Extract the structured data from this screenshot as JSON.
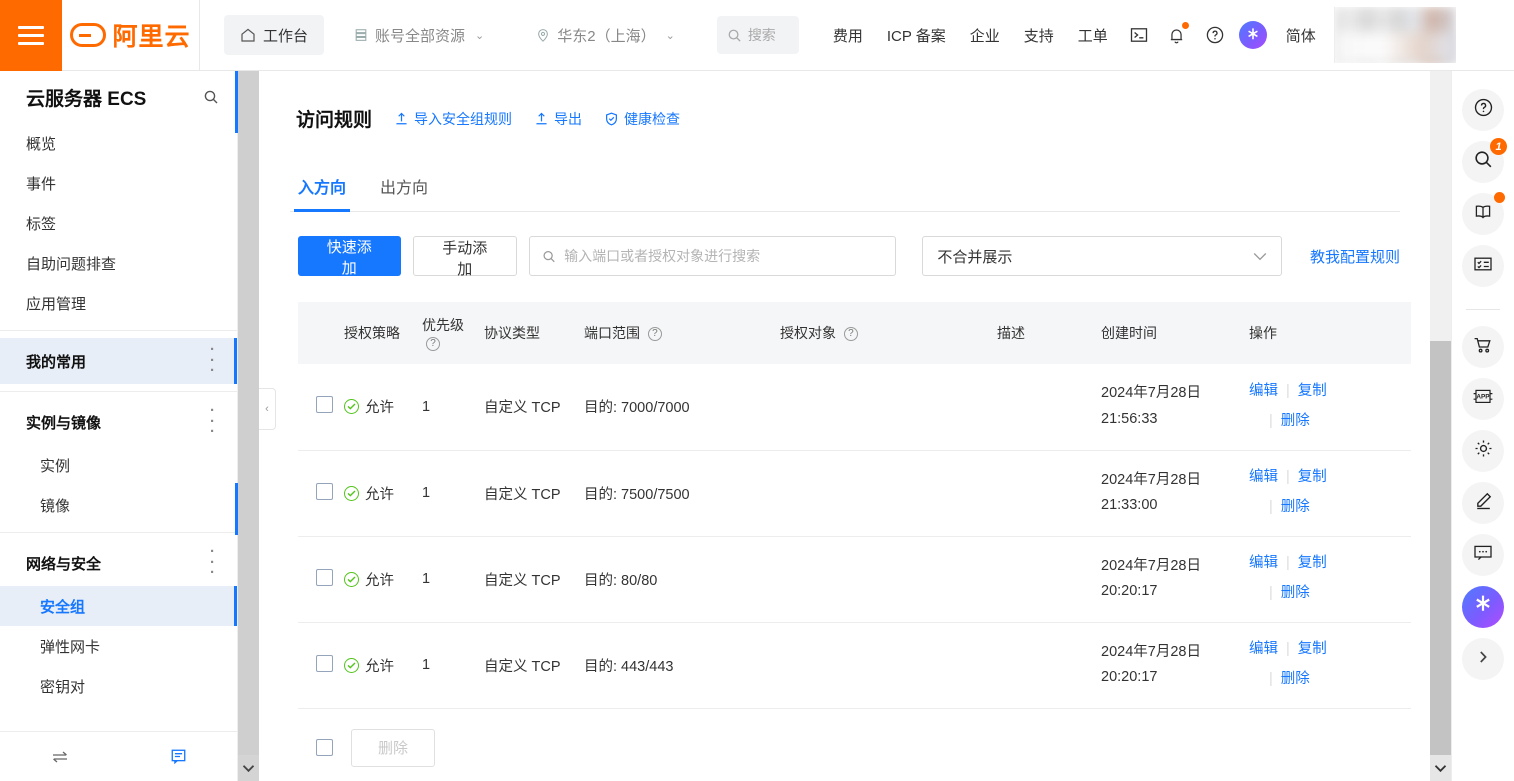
{
  "header": {
    "menu_icon": "hamburger-icon",
    "logo_text": "阿里云",
    "workbench": "工作台",
    "home_icon": "home-icon",
    "resources": "账号全部资源",
    "resources_icon": "server-icon",
    "region": "华东2（上海）",
    "region_icon": "location-pin-icon",
    "search_placeholder": "搜索",
    "search_icon": "search-icon",
    "links": [
      "费用",
      "ICP 备案",
      "企业",
      "支持",
      "工单"
    ],
    "icons": [
      "terminal-icon",
      "bell-icon",
      "question-circle-icon"
    ],
    "ai_icon": "ai-assistant-icon",
    "language": "简体"
  },
  "sidebar": {
    "title": "云服务器 ECS",
    "search_icon": "search-icon",
    "items": [
      {
        "label": "概览",
        "type": "item"
      },
      {
        "label": "事件",
        "type": "item"
      },
      {
        "label": "标签",
        "type": "item"
      },
      {
        "label": "自助问题排查",
        "type": "item"
      },
      {
        "label": "应用管理",
        "type": "item"
      }
    ],
    "groups": [
      {
        "label": "我的常用",
        "selected": true,
        "children": []
      },
      {
        "label": "实例与镜像",
        "selected": false,
        "children": [
          {
            "label": "实例",
            "active": false
          },
          {
            "label": "镜像",
            "active": false
          }
        ]
      },
      {
        "label": "网络与安全",
        "selected": false,
        "children": [
          {
            "label": "安全组",
            "active": true
          },
          {
            "label": "弹性网卡",
            "active": false
          },
          {
            "label": "密钥对",
            "active": false
          }
        ]
      }
    ],
    "more_icon": "more-vertical-icon",
    "footer_icons": [
      "switch-icon",
      "feedback-icon"
    ]
  },
  "collapse_handle_icon": "chevron-left-icon",
  "main": {
    "page_title": "访问规则",
    "head_actions": [
      {
        "label": "导入安全组规则",
        "icon": "upload-icon"
      },
      {
        "label": "导出",
        "icon": "download-icon"
      },
      {
        "label": "健康检查",
        "icon": "shield-check-icon"
      }
    ],
    "tabs": [
      {
        "label": "入方向",
        "active": true
      },
      {
        "label": "出方向",
        "active": false
      }
    ],
    "toolbar": {
      "quick_add": "快速添加",
      "manual_add": "手动添加",
      "search_placeholder": "输入端口或者授权对象进行搜索",
      "search_value": "",
      "search_icon": "search-icon",
      "merge_select": "不合并展示",
      "merge_caret_icon": "chevron-down-icon",
      "teach_link": "教我配置规则"
    },
    "table": {
      "columns": [
        {
          "label": "授权策略",
          "help": false
        },
        {
          "label": "优先级",
          "help": true
        },
        {
          "label": "协议类型",
          "help": false
        },
        {
          "label": "端口范围",
          "help": true
        },
        {
          "label": "授权对象",
          "help": true
        },
        {
          "label": "描述",
          "help": false
        },
        {
          "label": "创建时间",
          "help": false
        },
        {
          "label": "操作",
          "help": false
        }
      ],
      "rows": [
        {
          "policy": "允许",
          "policy_icon": "check-circle-icon",
          "priority": "1",
          "protocol": "自定义 TCP",
          "port": "目的: 7000/7000",
          "target": "",
          "target_redacted": true,
          "description": "",
          "date": "2024年7月28日",
          "time": "21:56:33",
          "ops": [
            "编辑",
            "复制",
            "删除"
          ]
        },
        {
          "policy": "允许",
          "policy_icon": "check-circle-icon",
          "priority": "1",
          "protocol": "自定义 TCP",
          "port": "目的: 7500/7500",
          "target": "",
          "target_redacted": true,
          "description": "",
          "date": "2024年7月28日",
          "time": "21:33:00",
          "ops": [
            "编辑",
            "复制",
            "删除"
          ]
        },
        {
          "policy": "允许",
          "policy_icon": "check-circle-icon",
          "priority": "1",
          "protocol": "自定义 TCP",
          "port": "目的: 80/80",
          "target": "",
          "target_redacted": true,
          "description": "",
          "date": "2024年7月28日",
          "time": "20:20:17",
          "ops": [
            "编辑",
            "复制",
            "删除"
          ]
        },
        {
          "policy": "允许",
          "policy_icon": "check-circle-icon",
          "priority": "1",
          "protocol": "自定义 TCP",
          "port": "目的: 443/443",
          "target": "",
          "target_redacted": true,
          "description": "",
          "date": "2024年7月28日",
          "time": "20:20:17",
          "ops": [
            "编辑",
            "复制",
            "删除"
          ]
        }
      ],
      "footer_delete": "删除"
    }
  },
  "rail": {
    "items": [
      {
        "icon": "question-circle-icon",
        "badge": "",
        "dot": false
      },
      {
        "icon": "search-icon",
        "badge": "1",
        "dot": false
      },
      {
        "icon": "book-icon",
        "badge": "",
        "dot": true
      },
      {
        "icon": "checklist-icon",
        "badge": "",
        "dot": false
      }
    ],
    "items2": [
      {
        "icon": "cart-icon"
      },
      {
        "icon": "app-icon"
      },
      {
        "icon": "gear-icon"
      },
      {
        "icon": "pencil-icon"
      },
      {
        "icon": "chat-icon"
      }
    ],
    "ai_icon": "ai-assistant-icon",
    "expand_icon": "chevron-right-icon"
  },
  "colors": {
    "brand_orange": "#FF6A00",
    "primary_blue": "#1677FF",
    "success_green": "#52C41A"
  }
}
